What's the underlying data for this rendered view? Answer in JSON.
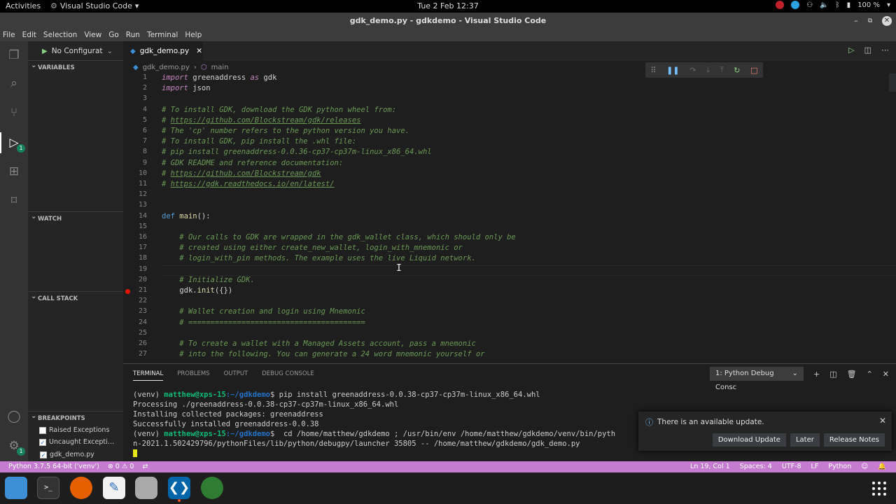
{
  "topbar": {
    "activities": "Activities",
    "app_name": "Visual Studio Code",
    "clock": "Tue 2 Feb  12:37",
    "battery": "100 %"
  },
  "window": {
    "title": "gdk_demo.py - gdkdemo - Visual Studio Code"
  },
  "menu": [
    "File",
    "Edit",
    "Selection",
    "View",
    "Go",
    "Run",
    "Terminal",
    "Help"
  ],
  "debug": {
    "config_label": "No Configurat",
    "sections": {
      "variables": "VARIABLES",
      "watch": "WATCH",
      "call_stack": "CALL STACK",
      "breakpoints": "BREAKPOINTS"
    },
    "breakpoints": [
      {
        "label": "Raised Exceptions",
        "checked": false
      },
      {
        "label": "Uncaught Excepti…",
        "checked": true
      },
      {
        "label": "gdk_demo.py",
        "checked": true
      }
    ]
  },
  "editor": {
    "tab_label": "gdk_demo.py",
    "breadcrumb": {
      "file": "gdk_demo.py",
      "symbol": "main"
    },
    "line_numbers": [
      "1",
      "2",
      "3",
      "4",
      "5",
      "6",
      "7",
      "8",
      "9",
      "10",
      "11",
      "12",
      "13",
      "14",
      "15",
      "16",
      "17",
      "18",
      "19",
      "20",
      "21",
      "22",
      "23",
      "24",
      "25",
      "26",
      "27"
    ],
    "lines": {
      "l1a": "import",
      "l1b": " greenaddress ",
      "l1c": "as",
      "l1d": " gdk",
      "l2a": "import",
      "l2b": " json",
      "l4": "# To install GDK, download the GDK python wheel from:",
      "l5": "https://github.com/Blockstream/gdk/releases",
      "l6": "# The 'cp' number refers to the python version you have.",
      "l7": "# To install GDK, pip install the .whl file:",
      "l8": "# pip install greenaddress-0.0.36-cp37-cp37m-linux_x86_64.whl",
      "l9": "# GDK README and reference documentation:",
      "l10": "https://github.com/Blockstream/gdk",
      "l11": "https://gdk.readthedocs.io/en/latest/",
      "hash": "# ",
      "l14a": "def",
      "l14b": "main",
      "l14c": "():",
      "l16": "# Our calls to GDK are wrapped in the gdk_wallet class, which should only be",
      "l17": "# created using either create_new_wallet, login_with_mnemonic or",
      "l18": "# login_with_pin methods. The example uses the live Liquid network.",
      "l20": "# Initialize GDK.",
      "l21a": "gdk.",
      "l21b": "init",
      "l21c": "({})",
      "l23": "# Wallet creation and login using Mnemonic",
      "l24": "# ========================================",
      "l26": "# To create a wallet with a Managed Assets account, pass a mnemonic",
      "l27": "# into the following. You can generate a 24 word mnemonic yourself or"
    }
  },
  "panel": {
    "tabs": [
      "TERMINAL",
      "PROBLEMS",
      "OUTPUT",
      "DEBUG CONSOLE"
    ],
    "terminal_select": "1: Python Debug Consc",
    "terminal": {
      "prompt1": "(venv) ",
      "user1": "matthew@xps-15",
      "path1": ":~/gdkdemo",
      "cmd1": "$ pip install greenaddress-0.0.38-cp37-cp37m-linux_x86_64.whl",
      "out1": "Processing ./greenaddress-0.0.38-cp37-cp37m-linux_x86_64.whl",
      "out2": "Installing collected packages: greenaddress",
      "out3": "Successfully installed greenaddress-0.0.38",
      "cmd2": "$  cd /home/matthew/gdkdemo ; /usr/bin/env /home/matthew/gdkdemo/venv/bin/pyth",
      "out4": "n-2021.1.502429796/pythonFiles/lib/python/debugpy/launcher 35805 -- /home/matthew/gdkdemo/gdk_demo.py"
    }
  },
  "notification": {
    "message": "There is an available update.",
    "buttons": [
      "Download Update",
      "Later",
      "Release Notes"
    ]
  },
  "statusbar": {
    "interpreter": "Python 3.7.5 64-bit ('venv')",
    "problems": "⊗ 0 ⚠ 0",
    "position": "Ln 19, Col 1",
    "spaces": "Spaces: 4",
    "encoding": "UTF-8",
    "eol": "LF",
    "language": "Python"
  },
  "colors": {
    "statusbar": "#c47bd0",
    "accent": "#0dbc79",
    "breakpoint": "#e51400"
  }
}
